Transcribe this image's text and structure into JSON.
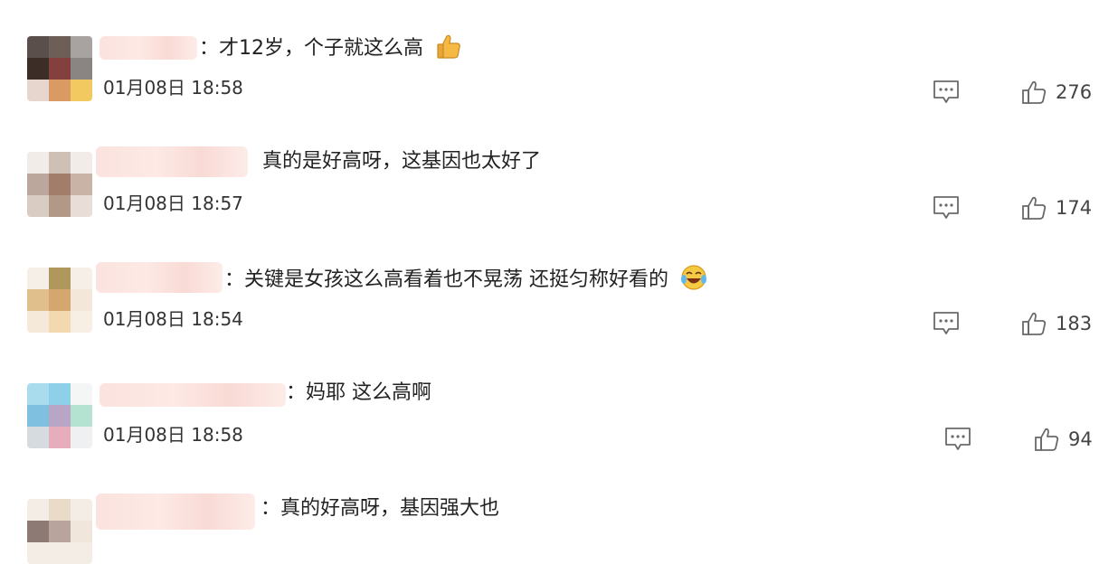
{
  "comments": [
    {
      "separator": "：",
      "text": "才12岁，个子就这么高",
      "emoji": "thumbs-up",
      "date": "01月08日",
      "time": "18:58",
      "likes": "276",
      "avatar_colors": [
        "#5b4f4c",
        "#6e5e58",
        "#a8a3a1",
        "#3c2d27",
        "#84403f",
        "#8a8483",
        "#e6d6ce",
        "#d99a63",
        "#f2c860"
      ]
    },
    {
      "separator": "",
      "text": "真的是好高呀，这基因也太好了",
      "emoji": "",
      "date": "01月08日",
      "time": "18:57",
      "likes": "174",
      "avatar_colors": [
        "#f2ece8",
        "#cfc0b6",
        "#f2ece8",
        "#bba79b",
        "#a17d6a",
        "#c9b3a6",
        "#d8ccc3",
        "#b29887",
        "#e8ded7"
      ]
    },
    {
      "separator": "：",
      "text": "关键是女孩这么高看着也不晃荡 还挺匀称好看的",
      "emoji": "laughing-tears",
      "date": "01月08日",
      "time": "18:54",
      "likes": "183",
      "avatar_colors": [
        "#f5efe7",
        "#b0985d",
        "#f5efe7",
        "#e0bf8d",
        "#d4a770",
        "#f3e7d9",
        "#f5ead9",
        "#f3d9b0",
        "#f7efe3"
      ]
    },
    {
      "separator": "：",
      "text": "妈耶 这么高啊",
      "emoji": "",
      "date": "01月08日",
      "time": "18:58",
      "likes": "94",
      "avatar_colors": [
        "#a9dcec",
        "#8fd0e9",
        "#f4f6f6",
        "#7fbfe0",
        "#b7a6c6",
        "#b5e3d2",
        "#d6dbe0",
        "#e6aebc",
        "#eef0f2"
      ]
    },
    {
      "separator": "：",
      "text": "真的好高呀，基因强大也",
      "emoji": "",
      "date": "",
      "time": "",
      "likes": "",
      "avatar_colors": [
        "#f4ede6",
        "#e8dcc8",
        "#f4ede6",
        "#8e7a74",
        "#b8a39d",
        "#f0e6dc",
        "#f4ede6",
        "#f4ede6",
        "#f4ede6"
      ]
    }
  ],
  "accent_colors": {
    "name_blur": "#fbe3df",
    "icon_gray": "#6a6a6a"
  }
}
